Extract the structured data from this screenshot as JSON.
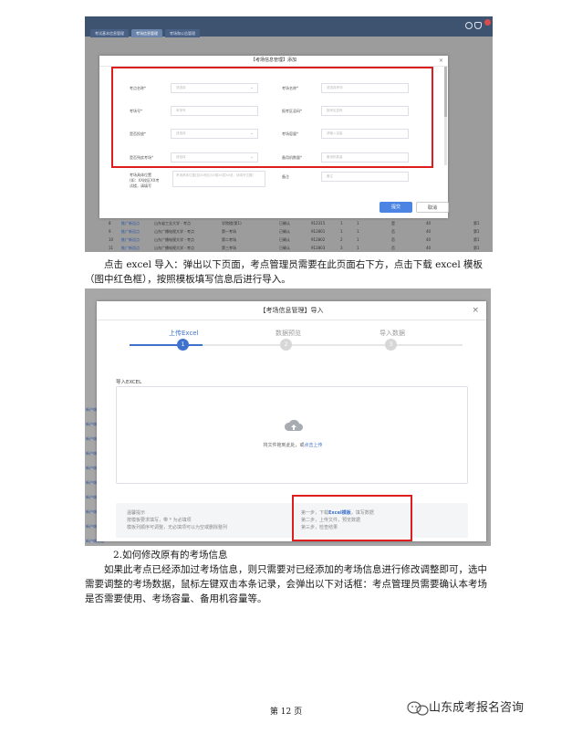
{
  "shot1": {
    "tabs": [
      "考试基本信息管理",
      "考场信息管理",
      "考场和公告管理"
    ],
    "modal_title": "【考场信息管理】添加",
    "fields": [
      {
        "label": "考点名称*",
        "placeholder": "请选择",
        "select": true
      },
      {
        "label": "考场名称*",
        "placeholder": "请选择考场",
        "select": false
      },
      {
        "label": "考场号*",
        "placeholder": "考场号",
        "select": false
      },
      {
        "label": "报考区县码*",
        "placeholder": "报考区县码",
        "select": false
      },
      {
        "label": "是否投放*",
        "placeholder": "请选择",
        "select": true
      },
      {
        "label": "考场容量*",
        "placeholder": "请输入容量",
        "select": false
      },
      {
        "label": "是否残疾考场*",
        "placeholder": "请选择",
        "select": true
      },
      {
        "label": "备用机数量*",
        "placeholder": "备用机数量",
        "select": false
      }
    ],
    "textarea_label": "考场具体位置(如：XX校区XX楼XX层XX室，请填写)",
    "textarea_label_lines": [
      "考场具体位置",
      "(如：XX校区XX考",
      "试楼，请填写"
    ],
    "textarea_placeholder": "考场具体位置(如XX校区XX楼XX层XX室，请填写位置)",
    "remark_label": "备注",
    "remark_placeholder": "备注",
    "submit": "提交",
    "cancel": "取消",
    "bg_rows": [
      {
        "n": "8",
        "link": "推广新设点",
        "school": "山东省工业大学 - 考点",
        "room": "学院楼(第1)",
        "status": "已确认",
        "code": "912315",
        "a": "1",
        "b": "1",
        "c": "是",
        "d": "40",
        "e": "第1"
      },
      {
        "n": "9",
        "link": "推广新设点",
        "school": "山东广播电视大学 - 考点",
        "room": "第一考场",
        "status": "已确认",
        "code": "912801",
        "a": "1",
        "b": "1",
        "c": "否",
        "d": "40",
        "e": "第1"
      },
      {
        "n": "10",
        "link": "推广新设点",
        "school": "山东广播电视大学 - 考点",
        "room": "第二考场",
        "status": "已确认",
        "code": "912802",
        "a": "2",
        "b": "1",
        "c": "否",
        "d": "40",
        "e": "第1"
      },
      {
        "n": "11",
        "link": "推广新设点",
        "school": "山东广播电视大学 - 考点",
        "room": "第三考场",
        "status": "已确认",
        "code": "912803",
        "a": "3",
        "b": "1",
        "c": "否",
        "d": "40",
        "e": "第1"
      }
    ]
  },
  "para1": {
    "text": "点击 excel 导入：弹出以下页面，考点管理员需要在此页面右下方，点击下载 excel 模板（图中红色框），按照模板填写信息后进行导入。"
  },
  "shot2": {
    "title": "【考场信息管理】导入",
    "steps": [
      {
        "label": "上传Excel",
        "num": "1"
      },
      {
        "label": "数据预览",
        "num": "2"
      },
      {
        "label": "导入数据",
        "num": "3"
      }
    ],
    "import_label": "导入EXCEL",
    "drop_text": "将文件拖到此处，或",
    "drop_link": "点击上传",
    "hint_title": "温馨提示",
    "hint_left": [
      "按模板要求填写，带 * 为必填项",
      "模板列顺序可调整，无必填项可以为空或删除整列"
    ],
    "hint_steps": [
      {
        "pre": "第一步，下载",
        "strong": "Excel模板",
        "post": "，填写数据"
      },
      {
        "pre": "第二步，上传文件，预览数据",
        "strong": "",
        "post": ""
      },
      {
        "pre": "第三步，检查结果",
        "strong": "",
        "post": ""
      }
    ],
    "left_links": [
      "新户城新设",
      "新户城新设",
      "新户城新设",
      "新户城新设",
      "新户城新设",
      "新户城新设",
      "新户城新设",
      "新户城新设",
      "新户城新设",
      "新户城新设"
    ]
  },
  "section2": {
    "heading": "2.如何修改原有的考场信息",
    "body": "如果此考点已经添加过考场信息，则只需要对已经添加的考场信息进行修改调整即可，选中需要调整的考场数据，鼠标左键双击本条记录，会弹出以下对话框：考点管理员需要确认本考场是否需要使用、考场容量、备用机容量等。"
  },
  "footer": {
    "page": "第 12 页",
    "watermark": "山东成考报名咨询"
  },
  "colors": {
    "highlight_red": "#de1e1e",
    "primary_blue": "#3f72cc",
    "nav_dark": "#3e5370"
  }
}
